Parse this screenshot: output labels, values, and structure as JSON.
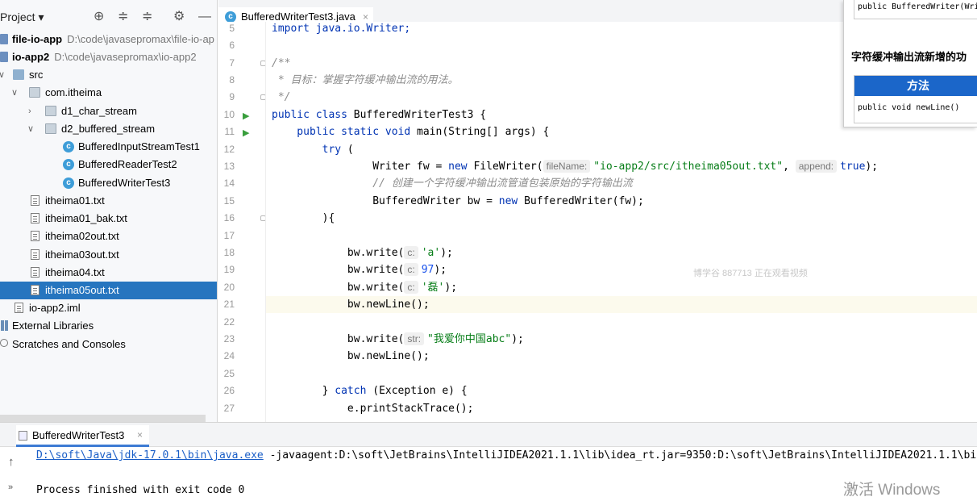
{
  "project": {
    "title": "Project",
    "toolbar_icons": [
      "locate-icon",
      "expand-all-icon",
      "collapse-all-icon",
      "gear-icon",
      "minimize-icon"
    ],
    "tree": [
      {
        "label": "file-io-app",
        "path": "D:\\code\\javasepromax\\file-io-ap",
        "icon": "module-folder",
        "bold": true
      },
      {
        "label": "io-app2",
        "path": "D:\\code\\javasepromax\\io-app2",
        "icon": "module-folder",
        "bold": true
      },
      {
        "label": "src",
        "icon": "source-folder"
      },
      {
        "label": "com.itheima",
        "icon": "package"
      },
      {
        "label": "d1_char_stream",
        "icon": "package"
      },
      {
        "label": "d2_buffered_stream",
        "icon": "package"
      },
      {
        "label": "BufferedInputStreamTest1",
        "icon": "class"
      },
      {
        "label": "BufferedReaderTest2",
        "icon": "class"
      },
      {
        "label": "BufferedWriterTest3",
        "icon": "class"
      },
      {
        "label": "itheima01.txt",
        "icon": "text-file"
      },
      {
        "label": "itheima01_bak.txt",
        "icon": "text-file"
      },
      {
        "label": "itheima02out.txt",
        "icon": "text-file"
      },
      {
        "label": "itheima03out.txt",
        "icon": "text-file"
      },
      {
        "label": "itheima04.txt",
        "icon": "text-file"
      },
      {
        "label": "itheima05out.txt",
        "icon": "text-file",
        "selected": true
      },
      {
        "label": "io-app2.iml",
        "icon": "module-file"
      },
      {
        "label": "External Libraries",
        "icon": "libraries"
      },
      {
        "label": "Scratches and Consoles",
        "icon": "scratches"
      }
    ]
  },
  "editor": {
    "tab_label": "BufferedWriterTest3.java",
    "tab_close": "×",
    "line_numbers": [
      "5",
      "6",
      "7",
      "8",
      "9",
      "10",
      "11",
      "12",
      "13",
      "14",
      "15",
      "16",
      "17",
      "18",
      "19",
      "20",
      "21",
      "22",
      "23",
      "24",
      "25",
      "26",
      "27"
    ],
    "lines": {
      "l5": "import java.io.Writer;",
      "l7": "/**",
      "l8": " * 目标：掌握字符缓冲输出流的用法。",
      "l9": " */",
      "l10a": "public class ",
      "l10b": "BufferedWriterTest3 {",
      "l11a": "    public static void ",
      "l11b": "main(String[] args) {",
      "l12a": "        try ",
      "l12b": "(",
      "l13a": "                Writer fw = ",
      "l13b": "new ",
      "l13c": "FileWriter(",
      "l13h1": "fileName:",
      "l13s": "\"io-app2/src/itheima05out.txt\"",
      "l13d": ", ",
      "l13h2": "append:",
      "l13k": "true",
      "l13e": ");",
      "l14": "                // 创建一个字符缓冲输出流管道包装原始的字符输出流",
      "l15a": "                BufferedWriter bw = ",
      "l15b": "new ",
      "l15c": "BufferedWriter(fw);",
      "l16": "        ){",
      "l18a": "            bw.write(",
      "l18h": "c:",
      "l18s": "'a'",
      "l18e": ");",
      "l19a": "            bw.write(",
      "l19h": "c:",
      "l19n": "97",
      "l19e": ");",
      "l20a": "            bw.write(",
      "l20h": "c:",
      "l20s": "'磊'",
      "l20e": ");",
      "l21": "            bw.newLine();",
      "l23a": "            bw.write(",
      "l23h": "str:",
      "l23s": "\"我爱你中国abc\"",
      "l23e": ");",
      "l24": "            bw.newLine();",
      "l26a": "        } ",
      "l26b": "catch ",
      "l26c": "(Exception e) {",
      "l27": "            e.printStackTrace();"
    }
  },
  "popup": {
    "code_snippet": "public BufferedWriter(Writ",
    "heading": "字符缓冲输出流新增的功",
    "table_header": "方法",
    "table_cell": "public void newLine()"
  },
  "watermark": "博学谷 887713 正在观看视频",
  "run": {
    "tab_label": "BufferedWriterTest3",
    "tab_close": "×",
    "cmd_link": "D:\\soft\\Java\\jdk-17.0.1\\bin\\java.exe",
    "cmd_rest": " -javaagent:D:\\soft\\JetBrains\\IntelliJIDEA2021.1.1\\lib\\idea_rt.jar=9350:D:\\soft\\JetBrains\\IntelliJIDEA2021.1.1\\bin",
    "exit_text": "Process finished with exit code 0"
  },
  "os_watermark": "激活 Windows"
}
